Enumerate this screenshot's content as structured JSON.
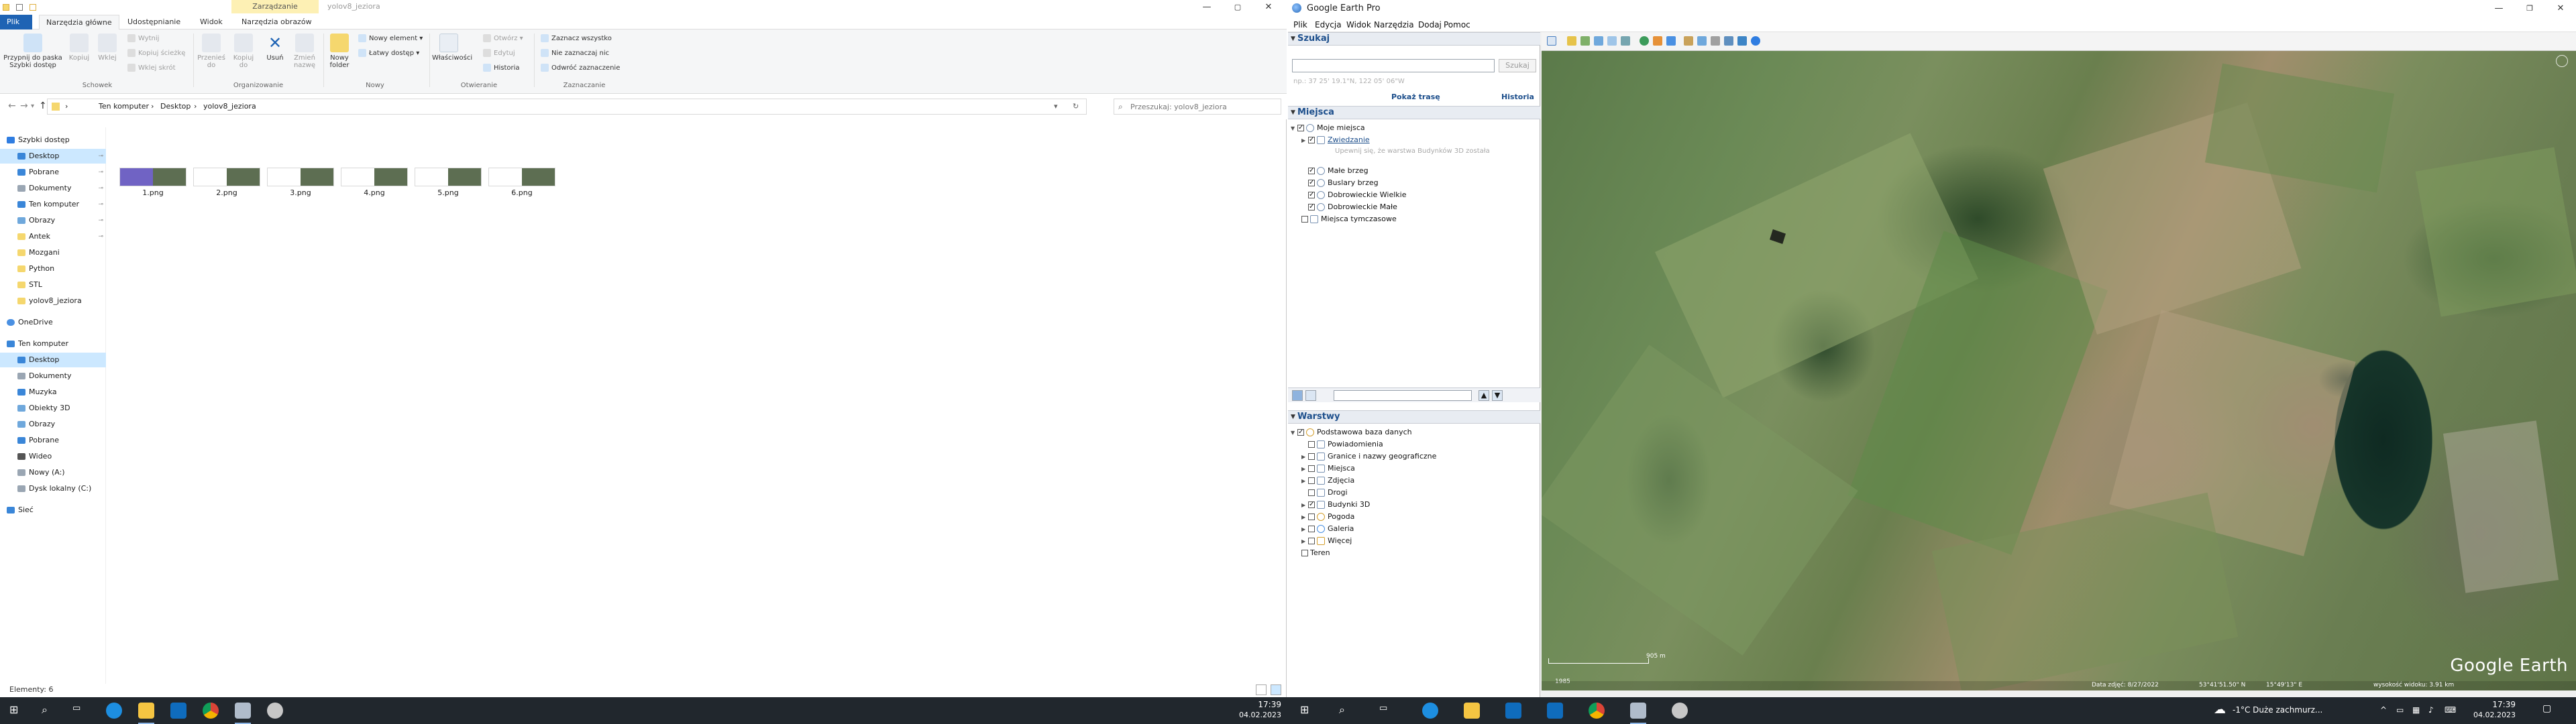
{
  "explorer": {
    "title": "yolov8_jeziora",
    "context_tab_label": "Zarządzanie",
    "ribbon_tabs": [
      "Plik",
      "Narzędzia główne",
      "Udostępnianie",
      "Widok",
      "Narzędzia obrazów"
    ],
    "ribbon": {
      "pin_label": "Przypnij do paska Szybki dostęp",
      "copy_label": "Kopiuj",
      "paste_label": "Wklej",
      "cut_label": "Wytnij",
      "copy_path_label": "Kopiuj ścieżkę",
      "paste_shortcut_label": "Wklej skrót",
      "move_to_label": "Przenieś do",
      "copy_to_label": "Kopiuj do",
      "delete_label": "Usuń",
      "rename_label": "Zmień nazwę",
      "new_folder_label": "Nowy folder",
      "new_item_label": "Nowy element",
      "easy_access_label": "Łatwy dostęp",
      "properties_label": "Właściwości",
      "open_label": "Otwórz",
      "edit_label": "Edytuj",
      "history_label": "Historia",
      "select_all_label": "Zaznacz wszystko",
      "select_none_label": "Nie zaznaczaj nic",
      "invert_selection_label": "Odwróć zaznaczenie",
      "groups": [
        "Schowek",
        "Organizowanie",
        "Nowy",
        "Otwieranie",
        "Zaznaczanie"
      ]
    },
    "breadcrumb": [
      "Ten komputer",
      "Desktop",
      "yolov8_jeziora"
    ],
    "search_placeholder": "Przeszukaj: yolov8_jeziora",
    "nav": {
      "quick_access": "Szybki dostęp",
      "quick_items": [
        "Desktop",
        "Pobrane",
        "Dokumenty",
        "Ten komputer",
        "Obrazy",
        "Antek",
        "Mozgani",
        "Python",
        "STL",
        "yolov8_jeziora"
      ],
      "onedrive": "OneDrive",
      "this_pc": "Ten komputer",
      "pc_items": [
        "Desktop",
        "Dokumenty",
        "Muzyka",
        "Obiekty 3D",
        "Obrazy",
        "Pobrane",
        "Wideo",
        "Nowy (A:)",
        "Dysk lokalny (C:)"
      ],
      "network": "Sieć"
    },
    "files": [
      "1.png",
      "2.png",
      "3.png",
      "4.png",
      "5.png",
      "6.png"
    ],
    "status": "Elementy: 6"
  },
  "gearth": {
    "title": "Google Earth Pro",
    "menus": [
      "Plik",
      "Edycja",
      "Widok",
      "Narzędzia",
      "Dodaj",
      "Pomoc"
    ],
    "search_head": "Szukaj",
    "search_button": "Szukaj",
    "search_hint": "np.: 37 25' 19.1\"N, 122 05' 06\"W",
    "show_routes": "Pokaż trasę",
    "history": "Historia",
    "places_head": "Miejsca",
    "my_places": "Moje miejsca",
    "tour": "Zwiedzanie",
    "tour_sub": "Upewnij się, że warstwa Budynków 3D została",
    "places": [
      "Małe brzeg",
      "Buslary brzeg",
      "Dobrowieckie Wielkie",
      "Dobrowieckie Małe"
    ],
    "temp_places": "Miejsca tymczasowe",
    "layers_head": "Warstwy",
    "primary_db": "Podstawowa baza danych",
    "layers": [
      "Powiadomienia",
      "Granice i nazwy geograficzne",
      "Miejsca",
      "Zdjęcia",
      "Drogi",
      "Budynki 3D",
      "Pogoda",
      "Galeria",
      "Więcej",
      "Teren"
    ],
    "watermark": "Google Earth",
    "scale_label": "905 m",
    "image_date": "1985",
    "status_items": [
      "Data zdjęć: 8/27/2022",
      "53°41'51.50\" N",
      "15°49'13\" E",
      "wysokość widoku: 3.91 km"
    ]
  },
  "taskbar": {
    "left_clock_time": "17:39",
    "left_clock_date": "04.02.2023",
    "weather": "-1°C  Duże zachmurz...",
    "right_clock_time": "17:39",
    "right_clock_date": "04.02.2023"
  }
}
